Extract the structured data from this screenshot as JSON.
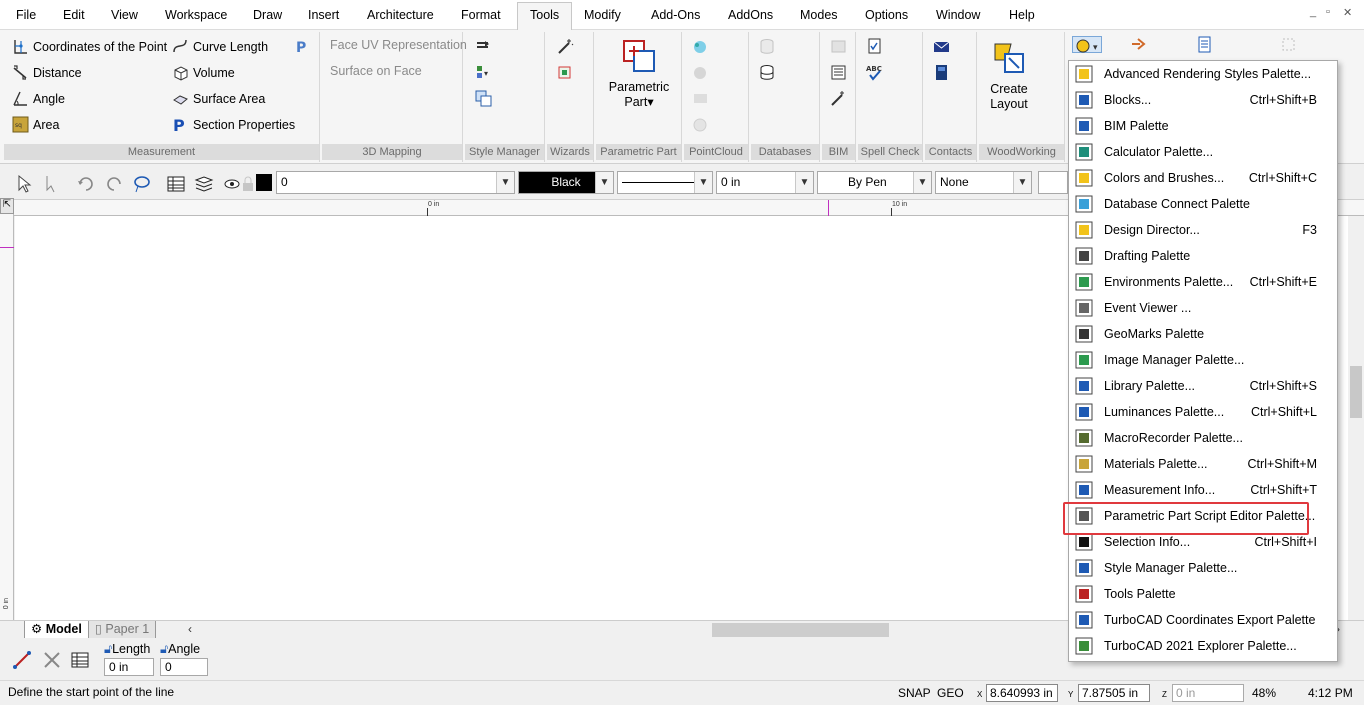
{
  "menu": [
    "File",
    "Edit",
    "View",
    "Workspace",
    "Draw",
    "Insert",
    "Architecture",
    "Format",
    "Tools",
    "Modify",
    "Add-Ons",
    "AddOns",
    "Modes",
    "Options",
    "Window",
    "Help"
  ],
  "window_controls": [
    "_",
    "▫",
    "✕"
  ],
  "measurement": {
    "label": "Measurement",
    "items": [
      "Coordinates of the Point",
      "Distance",
      "Angle",
      "Area",
      "Curve Length",
      "Volume",
      "Surface Area",
      "Section Properties"
    ]
  },
  "mapping": {
    "label": "3D Mapping",
    "items": [
      "Face UV Representation",
      "Surface on Face"
    ]
  },
  "groups": {
    "style_manager": "Style Manager",
    "wizards": "Wizards",
    "parametric_part": "Parametric Part",
    "parametric_part_button": [
      "Parametric",
      "Part▾"
    ],
    "pointcloud": "PointCloud",
    "databases": "Databases",
    "bim": "BIM",
    "spell_check": "Spell Check",
    "contacts": "Contacts",
    "woodworking": "WoodWorking",
    "create_layout": [
      "Create",
      "Layout"
    ]
  },
  "toolbar": {
    "layer_value": "0",
    "color_value": "Black",
    "width_value": "0 in",
    "pen_value": "By Pen",
    "pattern_value": "None"
  },
  "ruler": {
    "zero": "0 in",
    "ten": "10 in",
    "left_zero": "0 in"
  },
  "tabs": {
    "model": "Model",
    "paper": "Paper 1"
  },
  "inputs": {
    "length_label": "Length",
    "angle_label": "Angle",
    "length_value": "0 in",
    "angle_value": "0"
  },
  "status": {
    "prompt": "Define the start point of the line",
    "snap": "SNAP",
    "geo": "GEO",
    "x_label": "X",
    "y_label": "Y",
    "z_label": "Z",
    "x_value": "8.640993 in",
    "y_value": "7.87505 in",
    "z_value": "0 in",
    "zoom": "48%",
    "time": "4:12 PM"
  },
  "dropdown": [
    {
      "label": "Advanced Rendering Styles Palette...",
      "shortcut": "",
      "icon": "render-styles-icon"
    },
    {
      "label": "Blocks...",
      "shortcut": "Ctrl+Shift+B",
      "icon": "blocks-icon"
    },
    {
      "label": "BIM Palette",
      "shortcut": "",
      "icon": "bim-icon"
    },
    {
      "label": "Calculator Palette...",
      "shortcut": "",
      "icon": "calculator-icon"
    },
    {
      "label": "Colors and Brushes...",
      "shortcut": "Ctrl+Shift+C",
      "icon": "colors-icon"
    },
    {
      "label": "Database Connect Palette",
      "shortcut": "",
      "icon": "database-connect-icon"
    },
    {
      "label": "Design Director...",
      "shortcut": "F3",
      "icon": "design-director-icon"
    },
    {
      "label": "Drafting Palette",
      "shortcut": "",
      "icon": "drafting-icon"
    },
    {
      "label": "Environments Palette...",
      "shortcut": "Ctrl+Shift+E",
      "icon": "environments-icon"
    },
    {
      "label": "Event Viewer ...",
      "shortcut": "",
      "icon": "event-viewer-icon"
    },
    {
      "label": "GeoMarks Palette",
      "shortcut": "",
      "icon": "geomarks-icon"
    },
    {
      "label": "Image Manager Palette...",
      "shortcut": "",
      "icon": "image-manager-icon"
    },
    {
      "label": "Library Palette...",
      "shortcut": "Ctrl+Shift+S",
      "icon": "library-icon"
    },
    {
      "label": "Luminances Palette...",
      "shortcut": "Ctrl+Shift+L",
      "icon": "luminances-icon"
    },
    {
      "label": "MacroRecorder Palette...",
      "shortcut": "",
      "icon": "macro-recorder-icon"
    },
    {
      "label": "Materials Palette...",
      "shortcut": "Ctrl+Shift+M",
      "icon": "materials-icon"
    },
    {
      "label": "Measurement Info...",
      "shortcut": "Ctrl+Shift+T",
      "icon": "measurement-info-icon"
    },
    {
      "label": "Parametric Part Script Editor Palette...",
      "shortcut": "",
      "icon": "script-editor-icon"
    },
    {
      "label": "Selection Info...",
      "shortcut": "Ctrl+Shift+I",
      "icon": "selection-info-icon"
    },
    {
      "label": "Style Manager Palette...",
      "shortcut": "",
      "icon": "style-manager-icon"
    },
    {
      "label": "Tools Palette",
      "shortcut": "",
      "icon": "tools-palette-icon"
    },
    {
      "label": "TurboCAD Coordinates Export Palette",
      "shortcut": "",
      "icon": "coords-export-icon"
    },
    {
      "label": "TurboCAD 2021 Explorer Palette...",
      "shortcut": "",
      "icon": "explorer-icon"
    }
  ],
  "colors": {
    "highlight": "#e0393e",
    "accent": "#0078d7"
  }
}
